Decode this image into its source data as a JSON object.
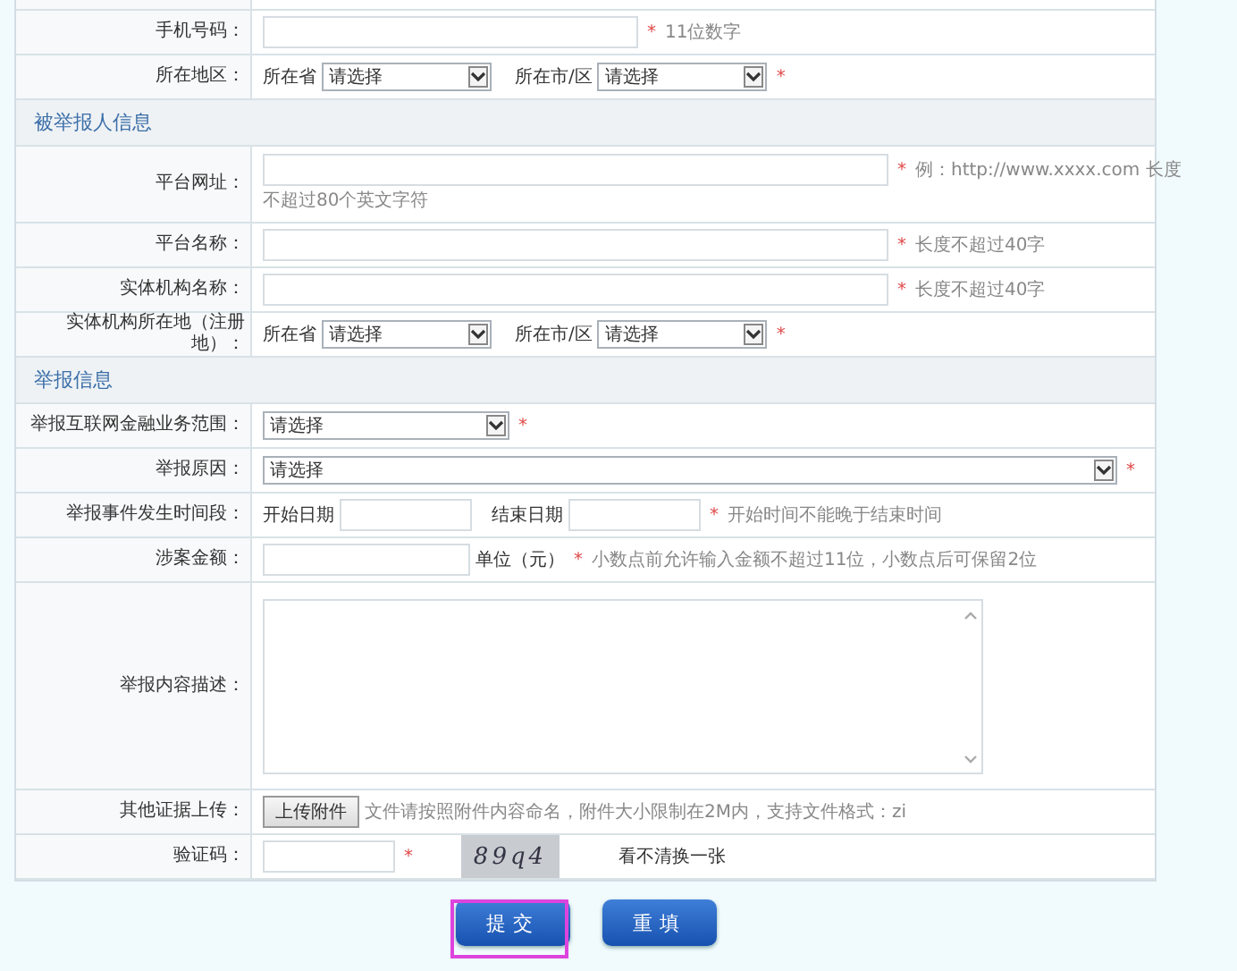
{
  "form": {
    "rows": [
      {
        "kind": "input",
        "label": "手机号码：",
        "mark": "*",
        "hint": "11位数字"
      },
      {
        "kind": "region",
        "label": "所在地区：",
        "province_label": "所在省",
        "province": "请选择",
        "city_label": "所在市/区",
        "city": "请选择",
        "mark": "*"
      },
      {
        "kind": "section",
        "title": "被举报人信息"
      },
      {
        "kind": "wide-input",
        "label": "平台网址：",
        "mark": "*",
        "hint": "例：http://www.xxxx.com 长度",
        "note": "不超过80个英文字符"
      },
      {
        "kind": "wide-input",
        "label": "平台名称：",
        "mark": "*",
        "hint": "长度不超过40字"
      },
      {
        "kind": "wide-input",
        "label": "实体机构名称：",
        "mark": "*",
        "hint": "长度不超过40字"
      },
      {
        "kind": "region",
        "label": "实体机构所在地（注册地）：",
        "province_label": "所在省",
        "province": "请选择",
        "city_label": "所在市/区",
        "city": "请选择",
        "mark": "*"
      },
      {
        "kind": "section",
        "title": "举报信息"
      },
      {
        "kind": "select",
        "label": "举报互联网金融业务范围：",
        "value": "请选择",
        "mark": "*"
      },
      {
        "kind": "wide-select",
        "label": "举报原因：",
        "value": "请选择",
        "mark": "*"
      },
      {
        "kind": "dates",
        "label": "举报事件发生时间段：",
        "start_label": "开始日期",
        "end_label": "结束日期",
        "mark": "*",
        "hint": "开始时间不能晚于结束时间"
      },
      {
        "kind": "amount",
        "label": "涉案金额：",
        "unit": "单位（元）",
        "mark": "*",
        "hint": "小数点前允许输入金额不超过11位，小数点后可保留2位"
      },
      {
        "kind": "textarea",
        "label": "举报内容描述："
      },
      {
        "kind": "upload",
        "label": "其他证据上传：",
        "button": "上传附件",
        "hint": "文件请按照附件内容命名，附件大小限制在2M内，支持文件格式：zi"
      },
      {
        "kind": "captcha",
        "label": "验证码：",
        "mark": "*",
        "code": "89q4",
        "refresh": "看不清换一张"
      }
    ]
  },
  "buttons": [
    {
      "label": "提交",
      "highlighted": true
    },
    {
      "label": "重填",
      "highlighted": false
    }
  ]
}
